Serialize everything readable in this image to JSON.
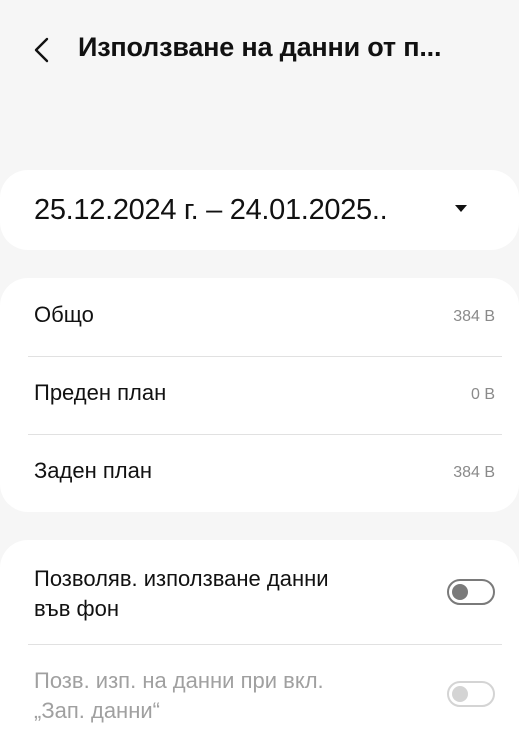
{
  "header": {
    "title": "Използване на данни от п..."
  },
  "date_range": {
    "value": "25.12.2024 г. – 24.01.2025.."
  },
  "usage": [
    {
      "label": "Общо",
      "value": "384 B"
    },
    {
      "label": "Преден план",
      "value": "0 B"
    },
    {
      "label": "Заден план",
      "value": "384 B"
    }
  ],
  "settings": {
    "background_data": {
      "label_line1": "Позволяв. използване данни",
      "label_line2": "във фон",
      "enabled": false
    },
    "data_saver": {
      "label_line1": "Позв. изп. на данни при вкл.",
      "label_line2": "„Зап. данни“",
      "enabled": false,
      "disabled": true
    }
  },
  "colors": {
    "background": "#f6f6f6",
    "card": "#ffffff",
    "disabled_text": "#a0a0a0",
    "secondary_text": "#8a8a8a"
  }
}
